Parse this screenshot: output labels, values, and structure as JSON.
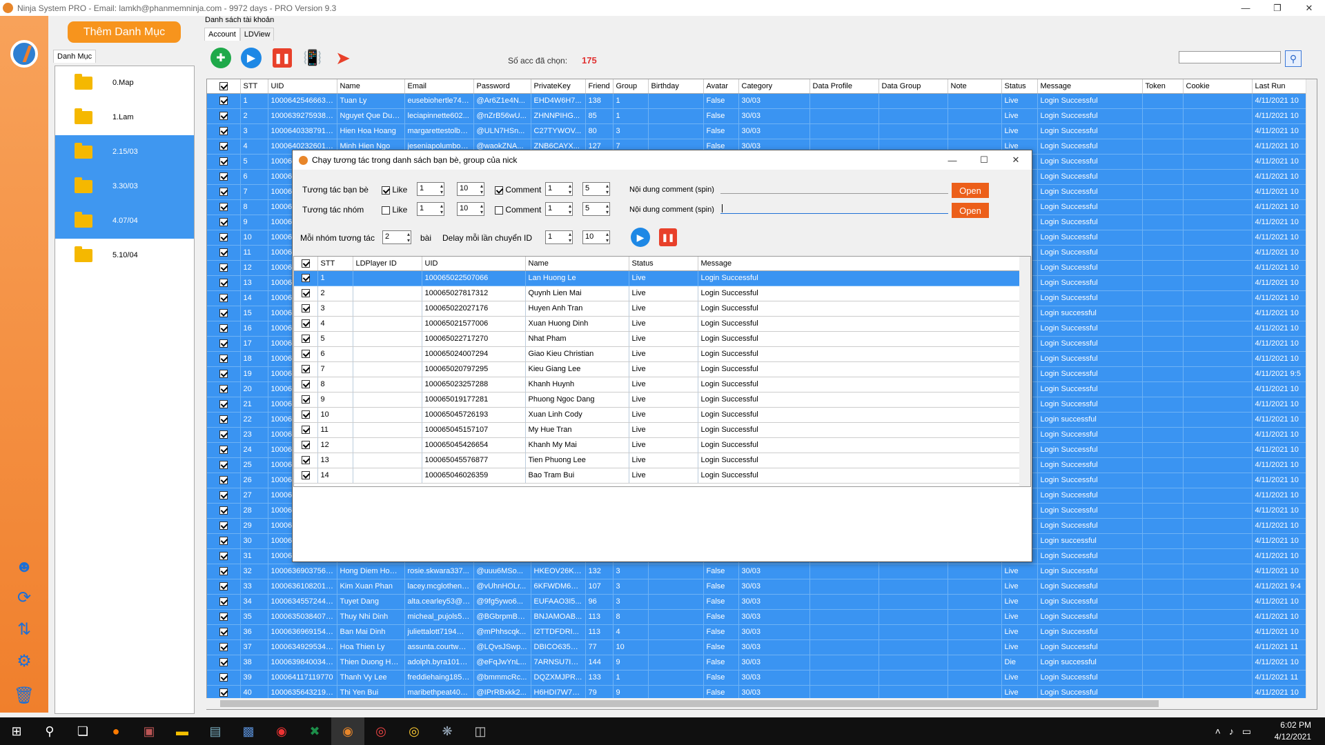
{
  "window": {
    "title": "Ninja System PRO - Email: lamkh@phanmemninja.com - 9972 days - PRO Version 9.3"
  },
  "sidebar": {
    "add_button": "Thêm Danh Mục",
    "tab": "Danh Mục",
    "categories": [
      "0.Map",
      "1.Lam",
      "2.15/03",
      "3.30/03",
      "4.07/04",
      "5.10/04"
    ],
    "selected": [
      2,
      3,
      4
    ]
  },
  "main": {
    "label": "Danh sách tài khoản",
    "tabs": [
      "Account",
      "LDView"
    ],
    "selected_label": "Số acc đã chọn:",
    "selected_count": "175"
  },
  "grid": {
    "columns": [
      "STT",
      "UID",
      "Name",
      "Email",
      "Password",
      "PrivateKey",
      "Friend",
      "Group",
      "Birthday",
      "Avatar",
      "Category",
      "Data Profile",
      "Data Group",
      "Note",
      "Status",
      "Message",
      "Token",
      "Cookie",
      "Last Run"
    ],
    "top_rows": [
      [
        "1",
        "100064254666365",
        "Tuan Ly",
        "eusebiohertle744...",
        "@Ar6Z1e4N...",
        "EHD4W6H7...",
        "138",
        "1",
        "",
        "False",
        "30/03",
        "",
        "",
        "",
        "Live",
        "Login Successful",
        "",
        "",
        "4/11/2021 10"
      ],
      [
        "2",
        "100063927593890",
        "Nguyet Que Duong",
        "leciapinnette602...",
        "@nZrB56wU...",
        "ZHNNPIHG...",
        "85",
        "1",
        "",
        "False",
        "30/03",
        "",
        "",
        "",
        "Live",
        "Login Successful",
        "",
        "",
        "4/11/2021 10"
      ],
      [
        "3",
        "100064033879134",
        "Hien Hoa Hoang",
        "margarettestolber...",
        "@ULN7HSn...",
        "C27TYWOV...",
        "80",
        "3",
        "",
        "False",
        "30/03",
        "",
        "",
        "",
        "Live",
        "Login Successful",
        "",
        "",
        "4/11/2021 10"
      ],
      [
        "4",
        "100064023260107",
        "Minh Hien Ngo",
        "jeseniapolumbo7...",
        "@waokZNA...",
        "ZNB6CAYX...",
        "127",
        "7",
        "",
        "False",
        "30/03",
        "",
        "",
        "",
        "Live",
        "Login Successful",
        "",
        "",
        "4/11/2021 10"
      ]
    ],
    "mid_rows": [
      [
        "5",
        "Login Successful",
        "4/11/2021 10"
      ],
      [
        "6",
        "Login Successful",
        "4/11/2021 10"
      ],
      [
        "7",
        "Login Successful",
        "4/11/2021 10"
      ],
      [
        "8",
        "Login Successful",
        "4/11/2021 10"
      ],
      [
        "9",
        "Login Successful",
        "4/11/2021 10"
      ],
      [
        "10",
        "Login Successful",
        "4/11/2021 10"
      ],
      [
        "11",
        "Login Successful",
        "4/11/2021 10"
      ],
      [
        "12",
        "Login Successful",
        "4/11/2021 10"
      ],
      [
        "13",
        "Login Successful",
        "4/11/2021 10"
      ],
      [
        "14",
        "Login Successful",
        "4/11/2021 10"
      ],
      [
        "15",
        "Login successful",
        "4/11/2021 10"
      ],
      [
        "16",
        "Login Successful",
        "4/11/2021 10"
      ],
      [
        "17",
        "Login Successful",
        "4/11/2021 10"
      ],
      [
        "18",
        "Login Successful",
        "4/11/2021 10"
      ],
      [
        "19",
        "Login Successful",
        "4/11/2021 9:5"
      ],
      [
        "20",
        "Login Successful",
        "4/11/2021 10"
      ],
      [
        "21",
        "Login Successful",
        "4/11/2021 10"
      ],
      [
        "22",
        "Login successful",
        "4/11/2021 10"
      ],
      [
        "23",
        "Login Successful",
        "4/11/2021 10"
      ],
      [
        "24",
        "Login Successful",
        "4/11/2021 10"
      ],
      [
        "25",
        "Login Successful",
        "4/11/2021 10"
      ],
      [
        "26",
        "Login Successful",
        "4/11/2021 10"
      ],
      [
        "27",
        "Login Successful",
        "4/11/2021 10"
      ],
      [
        "28",
        "Login Successful",
        "4/11/2021 10"
      ],
      [
        "29",
        "Login Successful",
        "4/11/2021 10"
      ],
      [
        "30",
        "Login successful",
        "4/11/2021 10"
      ],
      [
        "31",
        "Login Successful",
        "4/11/2021 10"
      ]
    ],
    "uid_prefix": "10006",
    "bottom_rows": [
      [
        "32",
        "100063690375665",
        "Hong Diem Hoang",
        "rosie.skwara337...",
        "@uuu6MSo...",
        "HKEOV26K6...",
        "132",
        "3",
        "",
        "False",
        "30/03",
        "",
        "",
        "",
        "Live",
        "Login Successful",
        "",
        "",
        "4/11/2021 10"
      ],
      [
        "33",
        "100063610820168",
        "Kim Xuan Phan",
        "lacey.mcglothen6...",
        "@vUhnHOLr...",
        "6KFWDM6X...",
        "107",
        "3",
        "",
        "False",
        "30/03",
        "",
        "",
        "",
        "Live",
        "Login Successful",
        "",
        "",
        "4/11/2021 9:4"
      ],
      [
        "34",
        "100063455724428",
        "Tuyet Dang",
        "alta.cearley53@h...",
        "@9fg5ywo6...",
        "EUFAAO3I5...",
        "96",
        "3",
        "",
        "False",
        "30/03",
        "",
        "",
        "",
        "Live",
        "Login Successful",
        "",
        "",
        "4/11/2021 10"
      ],
      [
        "35",
        "100063503840755",
        "Thuy Nhi Dinh",
        "micheal_pujols58...",
        "@BGbrpmBb...",
        "BNJAMOAB...",
        "113",
        "8",
        "",
        "False",
        "30/03",
        "",
        "",
        "",
        "Live",
        "Login Successful",
        "",
        "",
        "4/11/2021 10"
      ],
      [
        "36",
        "100063696915452",
        "Ban Mai Dinh",
        "juliettalott7194@...",
        "@mPhhscqk...",
        "I2TTDFDRI...",
        "113",
        "4",
        "",
        "False",
        "30/03",
        "",
        "",
        "",
        "Live",
        "Login Successful",
        "",
        "",
        "4/11/2021 10"
      ],
      [
        "37",
        "100063492953477",
        "Hoa Thien Ly",
        "assunta.courtway...",
        "@LQvsJSwp...",
        "DBICO635W...",
        "77",
        "10",
        "",
        "False",
        "30/03",
        "",
        "",
        "",
        "Live",
        "Login Successful",
        "",
        "",
        "4/11/2021 11"
      ],
      [
        "38",
        "100063984003439",
        "Thien Duong Ho...",
        "adolph.byra1012...",
        "@eFqJwYnL...",
        "7ARNSU7IE...",
        "144",
        "9",
        "",
        "False",
        "30/03",
        "",
        "",
        "",
        "Die",
        "Login successful",
        "",
        "",
        "4/11/2021 10"
      ],
      [
        "39",
        "100064117119770",
        "Thanh Vy Lee",
        "freddiehaing1854...",
        "@bmmmcRc...",
        "DQZXMJPR...",
        "133",
        "1",
        "",
        "False",
        "30/03",
        "",
        "",
        "",
        "Live",
        "Login Successful",
        "",
        "",
        "4/11/2021 11"
      ],
      [
        "40",
        "100063564321944",
        "Thi Yen Bui",
        "maribethpeat407...",
        "@IPrRBxkk2...",
        "H6HDI7W7P...",
        "79",
        "9",
        "",
        "False",
        "30/03",
        "",
        "",
        "",
        "Live",
        "Login Successful",
        "",
        "",
        "4/11/2021 10"
      ]
    ]
  },
  "dialog": {
    "title": "Chạy tương tác trong danh sách bạn bè, group của nick",
    "friends_label": "Tương tác bạn bè",
    "groups_label": "Tương tác nhóm",
    "like": "Like",
    "comment": "Comment",
    "row1": {
      "like_min": "1",
      "like_max": "10",
      "comment_min": "1",
      "comment_max": "5"
    },
    "row2": {
      "like_min": "1",
      "like_max": "10",
      "comment_min": "1",
      "comment_max": "5"
    },
    "comment_content_label": "Nội dung comment (spin)",
    "open": "Open",
    "per_group_label": "Mỗi nhóm tương tác",
    "per_group_value": "2",
    "posts_label": "bài",
    "delay_label": "Delay mỗi lần chuyển ID",
    "delay_min": "1",
    "delay_max": "10",
    "columns": [
      "STT",
      "LDPlayer ID",
      "UID",
      "Name",
      "Status",
      "Message"
    ],
    "rows": [
      [
        "1",
        "",
        "100065022507066",
        "Lan Huong Le",
        "Live",
        "Login Successful"
      ],
      [
        "2",
        "",
        "100065027817312",
        "Quynh Lien Mai",
        "Live",
        "Login Successful"
      ],
      [
        "3",
        "",
        "100065022027176",
        "Huyen Anh Tran",
        "Live",
        "Login Successful"
      ],
      [
        "4",
        "",
        "100065021577006",
        "Xuan Huong Dinh",
        "Live",
        "Login Successful"
      ],
      [
        "5",
        "",
        "100065022717270",
        "Nhat Pham",
        "Live",
        "Login Successful"
      ],
      [
        "6",
        "",
        "100065024007294",
        "Giao Kieu Christian",
        "Live",
        "Login Successful"
      ],
      [
        "7",
        "",
        "100065020797295",
        "Kieu Giang Lee",
        "Live",
        "Login Successful"
      ],
      [
        "8",
        "",
        "100065023257288",
        "Khanh Huynh",
        "Live",
        "Login Successful"
      ],
      [
        "9",
        "",
        "100065019177281",
        "Phuong Ngoc Dang",
        "Live",
        "Login Successful"
      ],
      [
        "10",
        "",
        "100065045726193",
        "Xuan Linh Cody",
        "Live",
        "Login Successful"
      ],
      [
        "11",
        "",
        "100065045157107",
        "My Hue Tran",
        "Live",
        "Login Successful"
      ],
      [
        "12",
        "",
        "100065045426654",
        "Khanh My Mai",
        "Live",
        "Login Successful"
      ],
      [
        "13",
        "",
        "100065045576877",
        "Tien Phuong Lee",
        "Live",
        "Login Successful"
      ],
      [
        "14",
        "",
        "100065046026359",
        "Bao Tram Bui",
        "Live",
        "Login Successful"
      ]
    ]
  },
  "taskbar": {
    "time": "6:02 PM",
    "date": "4/12/2021"
  }
}
